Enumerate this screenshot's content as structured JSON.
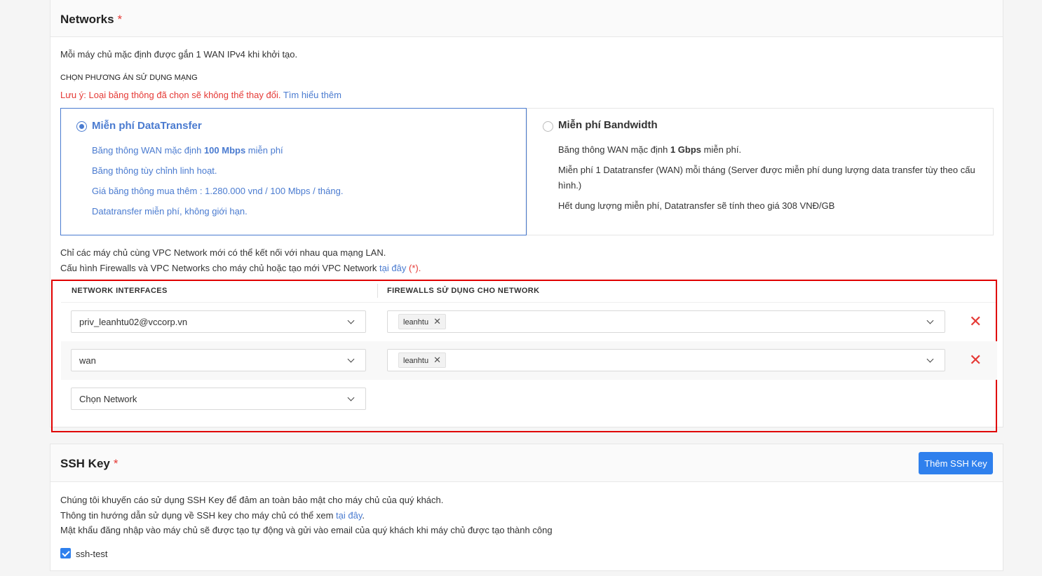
{
  "networks": {
    "title": "Networks",
    "required_mark": "*",
    "intro": "Mỗi máy chủ mặc định được gắn 1 WAN IPv4 khi khởi tạo.",
    "section_label": "CHỌN PHƯƠNG ÁN SỬ DỤNG MẠNG",
    "note": "Lưu ý: Loại băng thông đã chọn sẽ không thể thay đổi.",
    "learn_more": "Tìm hiểu thêm",
    "options": [
      {
        "title": "Miễn phí DataTransfer",
        "selected": true,
        "lines": [
          {
            "pre": "Băng thông WAN mặc định ",
            "bold": "100 Mbps",
            "post": " miễn phí"
          },
          {
            "pre": "Băng thông tùy chỉnh linh hoạt.",
            "bold": "",
            "post": ""
          },
          {
            "pre": "Giá băng thông mua thêm : 1.280.000 vnd / 100 Mbps / tháng.",
            "bold": "",
            "post": ""
          },
          {
            "pre": "Datatransfer miễn phí, không giới hạn.",
            "bold": "",
            "post": ""
          }
        ]
      },
      {
        "title": "Miễn phí Bandwidth",
        "selected": false,
        "lines": [
          {
            "pre": "Băng thông WAN mặc định ",
            "bold": "1 Gbps",
            "post": " miễn phí."
          },
          {
            "pre": "Miễn phí 1 Datatransfer (WAN) mỗi tháng (Server được miễn phí dung lượng data transfer tùy theo cấu",
            "bold": "",
            "post": ""
          },
          {
            "pre": "hình.)",
            "bold": "",
            "post": ""
          },
          {
            "pre": "Hết dung lượng miễn phí, Datatransfer sẽ tính theo giá 308 VNĐ/GB",
            "bold": "",
            "post": ""
          }
        ]
      }
    ],
    "vpc_note": "Chỉ các máy chủ cùng VPC Network mới có thể kết nối với nhau qua mạng LAN.",
    "config_note": "Cấu hình Firewalls và VPC Networks cho máy chủ hoặc tạo mới VPC Network",
    "config_link": "tại đây",
    "config_mark": "(*).",
    "table": {
      "col_interfaces": "NETWORK INTERFACES",
      "col_firewalls": "FIREWALLS SỬ DỤNG CHO NETWORK",
      "rows": [
        {
          "network": "priv_leanhtu02@vccorp.vn",
          "firewall_tag": "leanhtu"
        },
        {
          "network": "wan",
          "firewall_tag": "leanhtu"
        }
      ],
      "new_row_placeholder": "Chọn Network",
      "tag_remove": "✕",
      "delete_icon": "✕"
    }
  },
  "ssh": {
    "title": "SSH Key",
    "required_mark": "*",
    "add_button": "Thêm SSH Key",
    "line1": "Chúng tôi khuyến cáo sử dụng SSH Key để đảm an toàn bảo mật cho máy chủ của quý khách.",
    "line2": "Thông tin hướng dẫn sử dụng về SSH key cho máy chủ có thể xem",
    "line2_link": "tại đây",
    "line2_end": ".",
    "line3": "Mật khẩu đăng nhập vào máy chủ sẽ được tạo tự động và gửi vào email của quý khách khi máy chủ được tạo thành công",
    "keys": [
      {
        "name": "ssh-test",
        "checked": true
      }
    ]
  },
  "colors": {
    "accent": "#4a7bd0",
    "primary_button": "#2f80ed",
    "danger": "#e53935",
    "highlight_border": "#e00000"
  }
}
